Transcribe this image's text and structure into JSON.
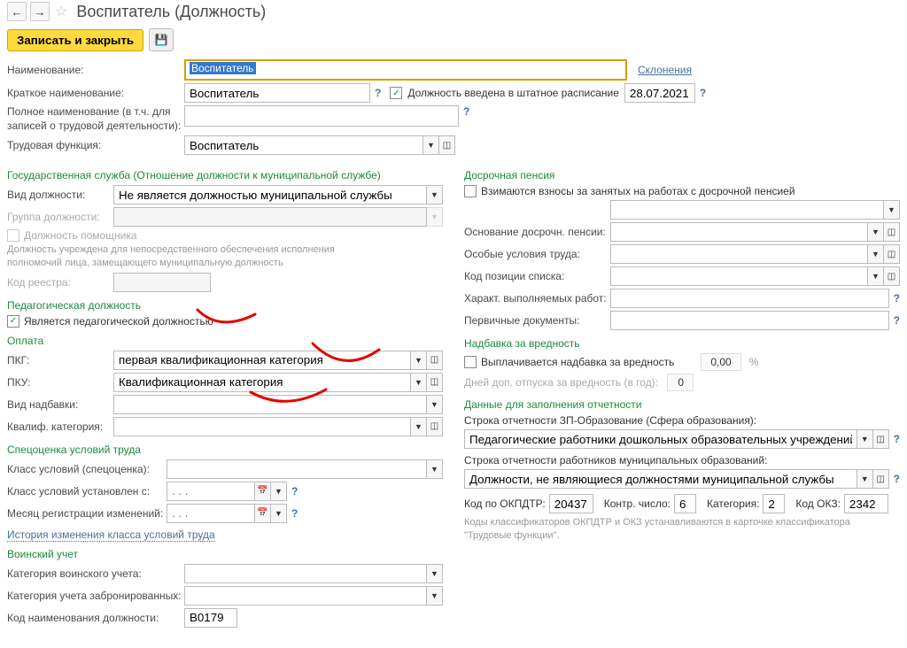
{
  "header": {
    "title": "Воспитатель (Должность)",
    "save_close": "Записать и закрыть"
  },
  "fields": {
    "name_lbl": "Наименование:",
    "name_val": "Воспитатель",
    "decl_link": "Склонения",
    "short_lbl": "Краткое наименование:",
    "short_val": "Воспитатель",
    "in_staffing_lbl": "Должность введена в штатное расписание",
    "in_staffing_date": "28.07.2021",
    "full_lbl": "Полное наименование (в т.ч. для записей о трудовой деятельности):",
    "labor_func_lbl": "Трудовая функция:",
    "labor_func_val": "Воспитатель"
  },
  "govservice": {
    "header": "Государственная служба (Отношение должности к муниципальной службе)",
    "position_type_lbl": "Вид должности:",
    "position_type_val": "Не является должностью муниципальной службы",
    "position_group_lbl": "Группа должности:",
    "assistant_lbl": "Должность помощника",
    "note": "Должность учреждена для непосредственного обеспечения исполнения полномочий лица, замещающего муниципальную должность",
    "reestr_lbl": "Код реестра:"
  },
  "pedag": {
    "header": "Педагогическая должность",
    "is_ped_lbl": "Является педагогической должностью"
  },
  "pay": {
    "header": "Оплата",
    "pkg_lbl": "ПКГ:",
    "pkg_val": "первая квалификационная категория",
    "pku_lbl": "ПКУ:",
    "pku_val": "Квалификационная категория",
    "allowance_lbl": "Вид надбавки:",
    "qualif_lbl": "Квалиф. категория:"
  },
  "special": {
    "header": "Спецоценка условий труда",
    "class_lbl": "Класс условий (спецоценка):",
    "class_set_lbl": "Класс условий установлен с:",
    "month_lbl": "Месяц регистрации изменений:",
    "date_placeholder": ". . .",
    "history_link": "История изменения класса условий труда"
  },
  "military": {
    "header": "Воинский учет",
    "cat_lbl": "Категория воинского учета:",
    "booked_lbl": "Категория учета забронированных:",
    "code_lbl": "Код наименования должности:",
    "code_val": "В0179"
  },
  "earlypension": {
    "header": "Досрочная пенсия",
    "contrib_lbl": "Взимаются взносы за занятых на работах с досрочной пенсией",
    "basis_lbl": "Основание досрочн. пенсии:",
    "cond_lbl": "Особые условия труда:",
    "poscode_lbl": "Код позиции списка:",
    "work_lbl": "Характ. выполняемых работ:",
    "docs_lbl": "Первичные документы:"
  },
  "hazard": {
    "header": "Надбавка за вредность",
    "paid_lbl": "Выплачивается надбавка за вредность",
    "amount": "0,00",
    "pct": "%",
    "days_lbl": "Дней доп. отпуска за вредность (в год):",
    "days_val": "0"
  },
  "report": {
    "header": "Данные для заполнения отчетности",
    "zp_lbl": "Строка отчетности ЗП-Образование (Сфера образования):",
    "zp_val": "Педагогические работники дошкольных образовательных учреждений",
    "mun_lbl": "Строка отчетности работников муниципальных образований:",
    "mun_val": "Должности, не являющиеся должностями муниципальной службы",
    "okpdtr_lbl": "Код по ОКПДТР:",
    "okpdtr_val": "20437",
    "contr_lbl": "Контр. число:",
    "contr_val": "6",
    "cat_lbl": "Категория:",
    "cat_val": "2",
    "okz_lbl": "Код ОКЗ:",
    "okz_val": "2342",
    "footnote": "Коды классификаторов ОКПДТР и ОКЗ устанавливаются в карточке классификатора \"Трудовые функции\"."
  }
}
